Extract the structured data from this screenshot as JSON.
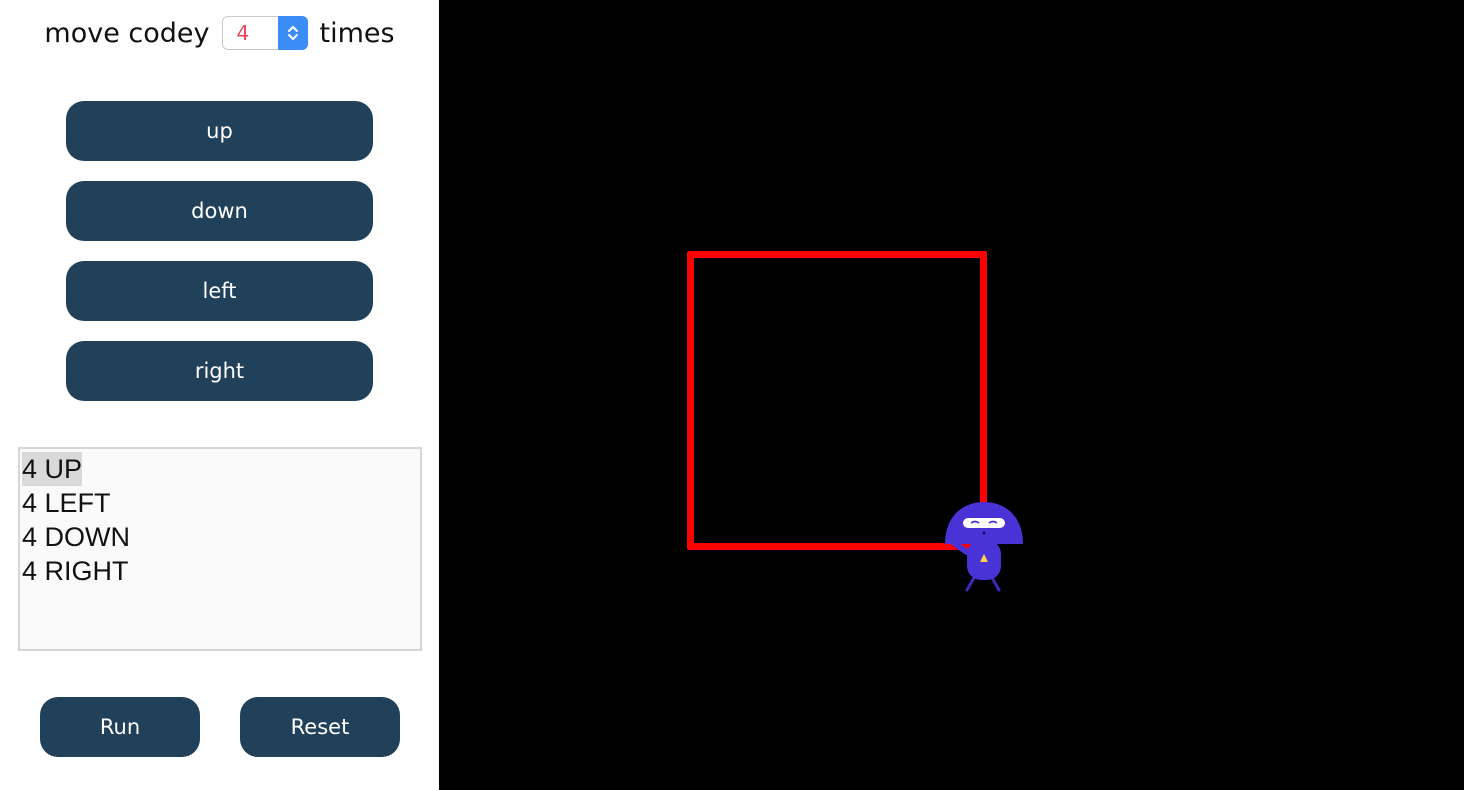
{
  "controls": {
    "move_label": "move codey",
    "times_label": "times",
    "count_value": "4"
  },
  "buttons": {
    "up": "up",
    "down": "down",
    "left": "left",
    "right": "right",
    "run": "Run",
    "reset": "Reset"
  },
  "command_list": {
    "items": [
      "4 UP",
      "4 LEFT",
      "4 DOWN",
      "4 RIGHT"
    ],
    "selected_index": 0
  },
  "colors": {
    "button_bg": "#21405a",
    "path_color": "#ff0000",
    "stage_bg": "#000000",
    "stepper_accent": "#3b8cf5",
    "codey_body": "#4a33d6"
  },
  "icons": {
    "stepper": "up-down-chevron-icon",
    "character": "codey-ninja-icon"
  }
}
